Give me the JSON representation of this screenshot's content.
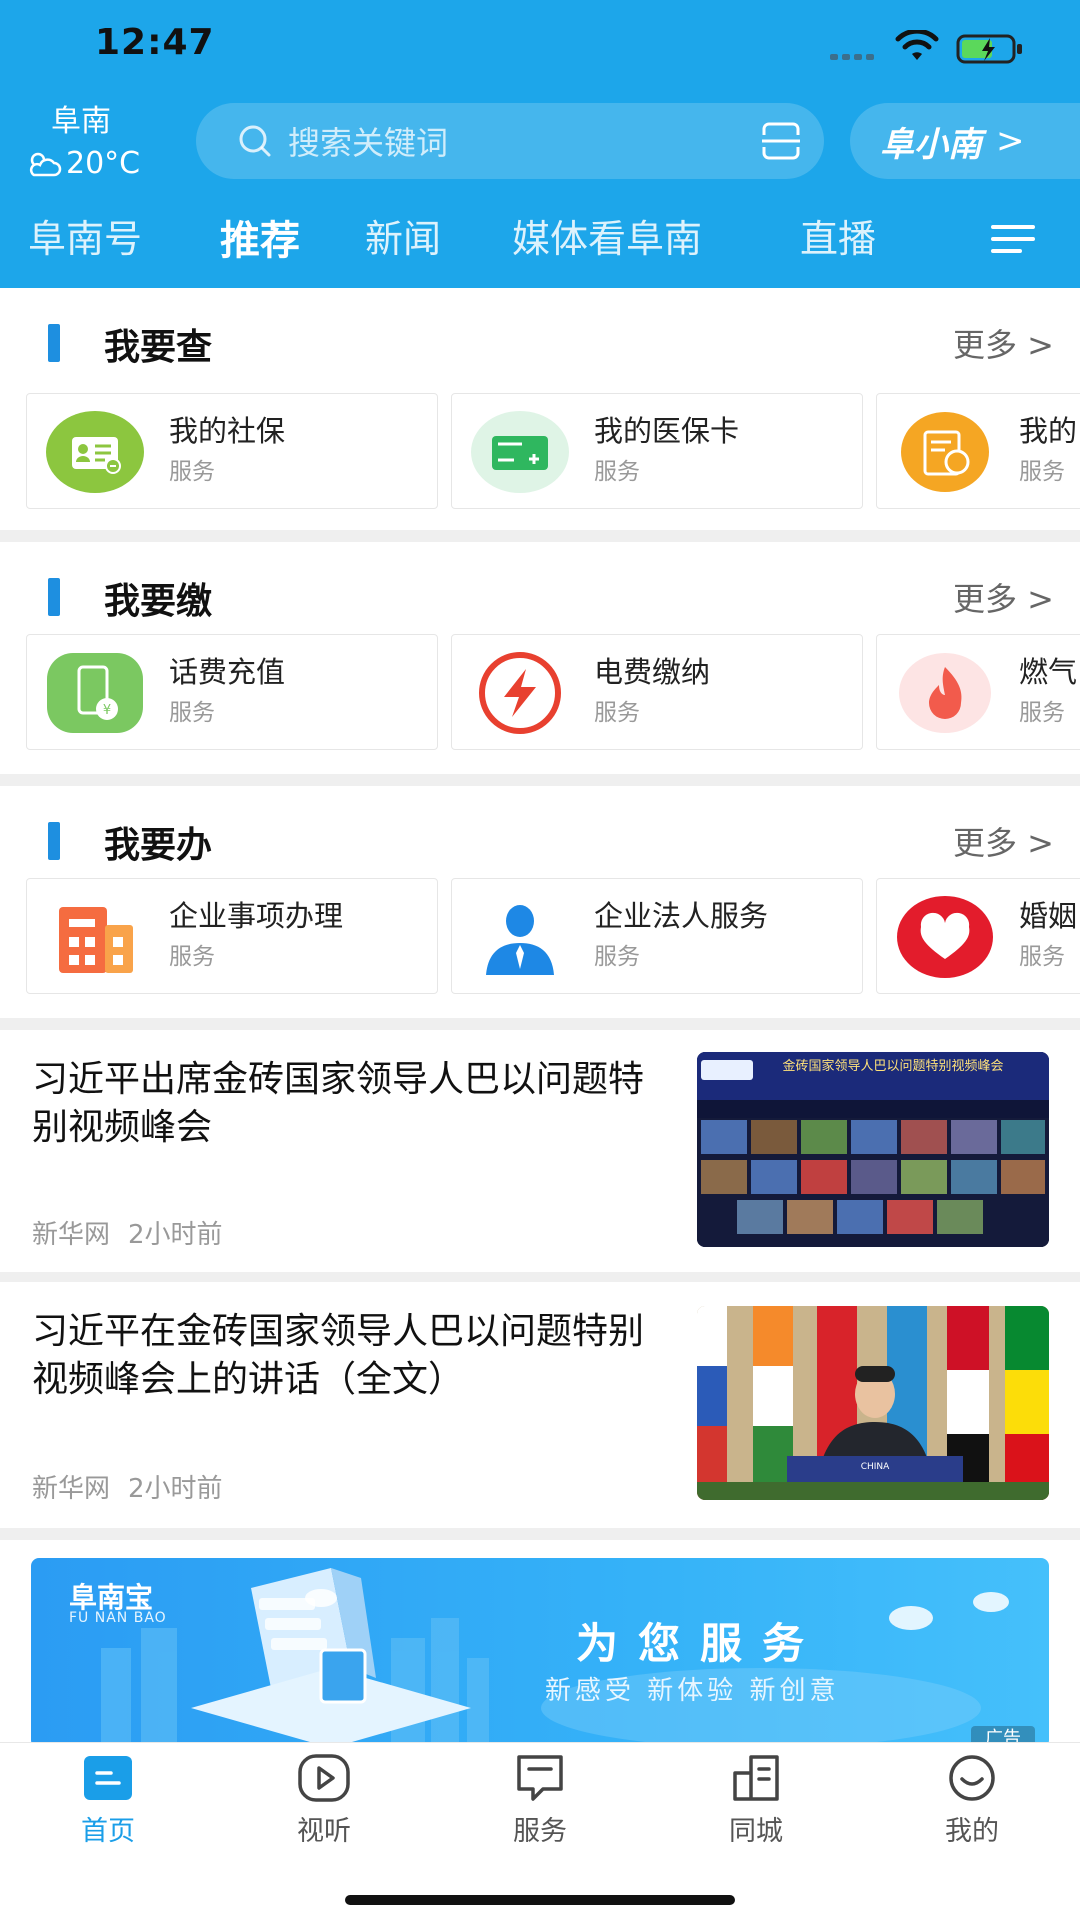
{
  "status_bar": {
    "time": "12:47"
  },
  "header": {
    "city": "阜南",
    "temperature": "20°C",
    "search_placeholder": "搜索关键词",
    "brand": "阜小南",
    "brand_arrow": ">"
  },
  "tabs": [
    {
      "label": "阜南号",
      "active": false
    },
    {
      "label": "推荐",
      "active": true
    },
    {
      "label": "新闻",
      "active": false
    },
    {
      "label": "媒体看阜南",
      "active": false
    },
    {
      "label": "直播",
      "active": false
    }
  ],
  "sections": [
    {
      "title": "我要查",
      "more": "更多 >",
      "cards": [
        {
          "title": "我的社保",
          "sub": "服务",
          "icon": "social-insurance-icon"
        },
        {
          "title": "我的医保卡",
          "sub": "服务",
          "icon": "medical-card-icon"
        },
        {
          "title": "我的",
          "sub": "服务",
          "icon": "fund-icon"
        }
      ]
    },
    {
      "title": "我要缴",
      "more": "更多 >",
      "cards": [
        {
          "title": "话费充值",
          "sub": "服务",
          "icon": "phone-recharge-icon"
        },
        {
          "title": "电费缴纳",
          "sub": "服务",
          "icon": "electricity-icon"
        },
        {
          "title": "燃气",
          "sub": "服务",
          "icon": "gas-flame-icon"
        }
      ]
    },
    {
      "title": "我要办",
      "more": "更多 >",
      "cards": [
        {
          "title": "企业事项办理",
          "sub": "服务",
          "icon": "enterprise-building-icon"
        },
        {
          "title": "企业法人服务",
          "sub": "服务",
          "icon": "legal-person-icon"
        },
        {
          "title": "婚姻",
          "sub": "服务",
          "icon": "heart-icon"
        }
      ]
    }
  ],
  "news": [
    {
      "title": "习近平出席金砖国家领导人巴以问题特别视频峰会",
      "source": "新华网",
      "time": "2小时前",
      "image_text": "金砖国家领导人巴以问题特别视频峰会"
    },
    {
      "title": "习近平在金砖国家领导人巴以问题特别视频峰会上的讲话（全文）",
      "source": "新华网",
      "time": "2小时前",
      "image_text": "CHINA"
    }
  ],
  "banner": {
    "logo": "阜南宝",
    "logo_sub": "FU NAN BAO",
    "main": "为您服务",
    "sub": "新感受 新体验 新创意",
    "ad_tag": "广告"
  },
  "bottom_nav": [
    {
      "label": "首页",
      "icon": "home-icon",
      "active": true
    },
    {
      "label": "视听",
      "icon": "play-icon",
      "active": false
    },
    {
      "label": "服务",
      "icon": "service-icon",
      "active": false
    },
    {
      "label": "同城",
      "icon": "city-icon",
      "active": false
    },
    {
      "label": "我的",
      "icon": "profile-icon",
      "active": false
    }
  ],
  "colors": {
    "header_blue": "#1da6ea",
    "accent_blue": "#1e8fe0",
    "nav_active": "#1a9ee8"
  }
}
